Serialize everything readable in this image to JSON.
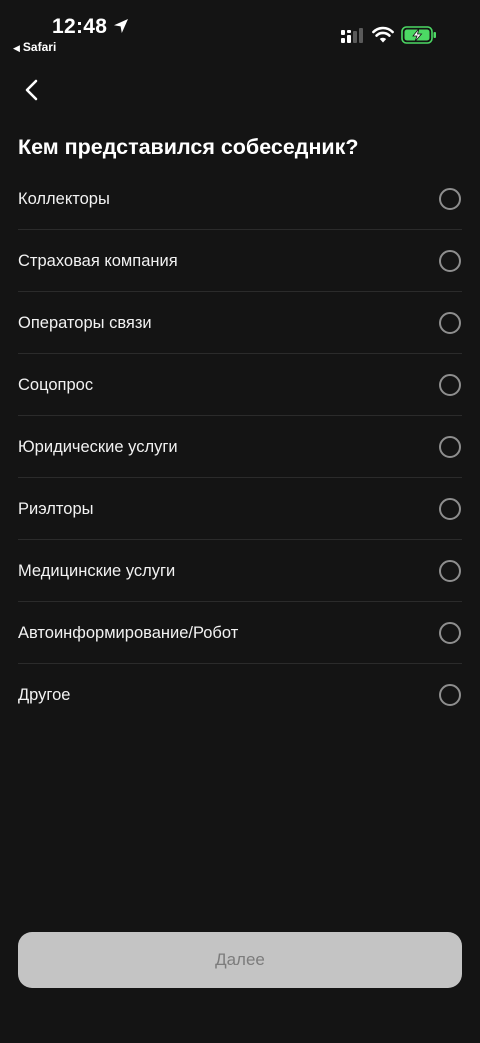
{
  "status_bar": {
    "time": "12:48",
    "back_app_label": "Safari",
    "battery_charging": true,
    "icons": [
      "location-arrow-icon",
      "signal-icon",
      "wifi-icon",
      "battery-charging-icon"
    ]
  },
  "nav": {
    "back_icon": "chevron-left-icon"
  },
  "title": "Кем представился собеседник?",
  "options": [
    {
      "label": "Коллекторы",
      "selected": false
    },
    {
      "label": "Страховая компания",
      "selected": false
    },
    {
      "label": "Операторы связи",
      "selected": false
    },
    {
      "label": "Соцопрос",
      "selected": false
    },
    {
      "label": "Юридические услуги",
      "selected": false
    },
    {
      "label": "Риэлторы",
      "selected": false
    },
    {
      "label": "Медицинские услуги",
      "selected": false
    },
    {
      "label": "Автоинформирование/Робот",
      "selected": false
    },
    {
      "label": "Другое",
      "selected": false
    }
  ],
  "next_button": {
    "label": "Далее",
    "enabled": false
  },
  "colors": {
    "background": "#141414",
    "text": "#ffffff",
    "divider": "#2b2b2b",
    "radio_border": "#8e8e8e",
    "button_disabled_bg": "#c4c4c4",
    "button_disabled_text": "#7c7c7c",
    "battery_green": "#4cd964"
  }
}
